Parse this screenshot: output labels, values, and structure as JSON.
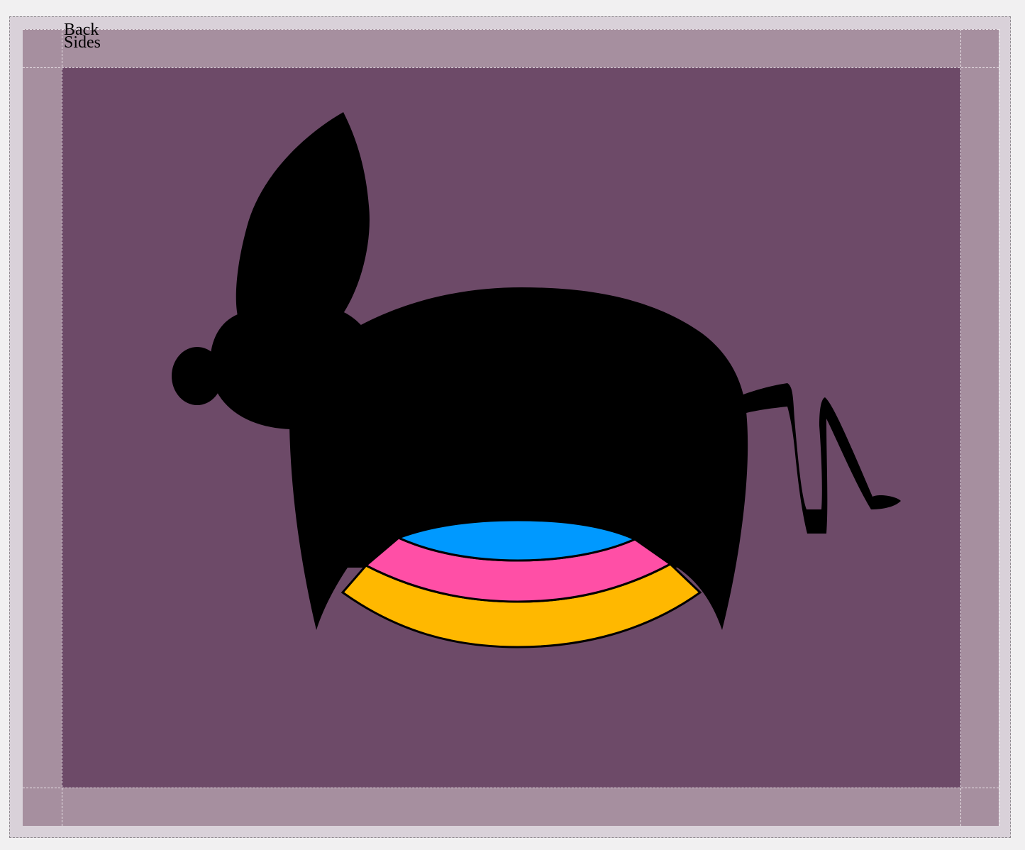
{
  "labels": {
    "back": "Back",
    "sides": "Sides"
  },
  "colors": {
    "page_background": "#f1f0f1",
    "outer_frame": "#d9d1d9",
    "bleed_area": "#a68f9f",
    "trim_area": "#6d4a68",
    "silhouette": "#000000",
    "stripe_blue": "#0099ff",
    "stripe_pink": "#ff4fa6",
    "stripe_yellow": "#ffb800"
  },
  "artwork": {
    "subject": "rabbit-silhouette",
    "stripes": [
      "blue",
      "pink",
      "yellow"
    ]
  }
}
